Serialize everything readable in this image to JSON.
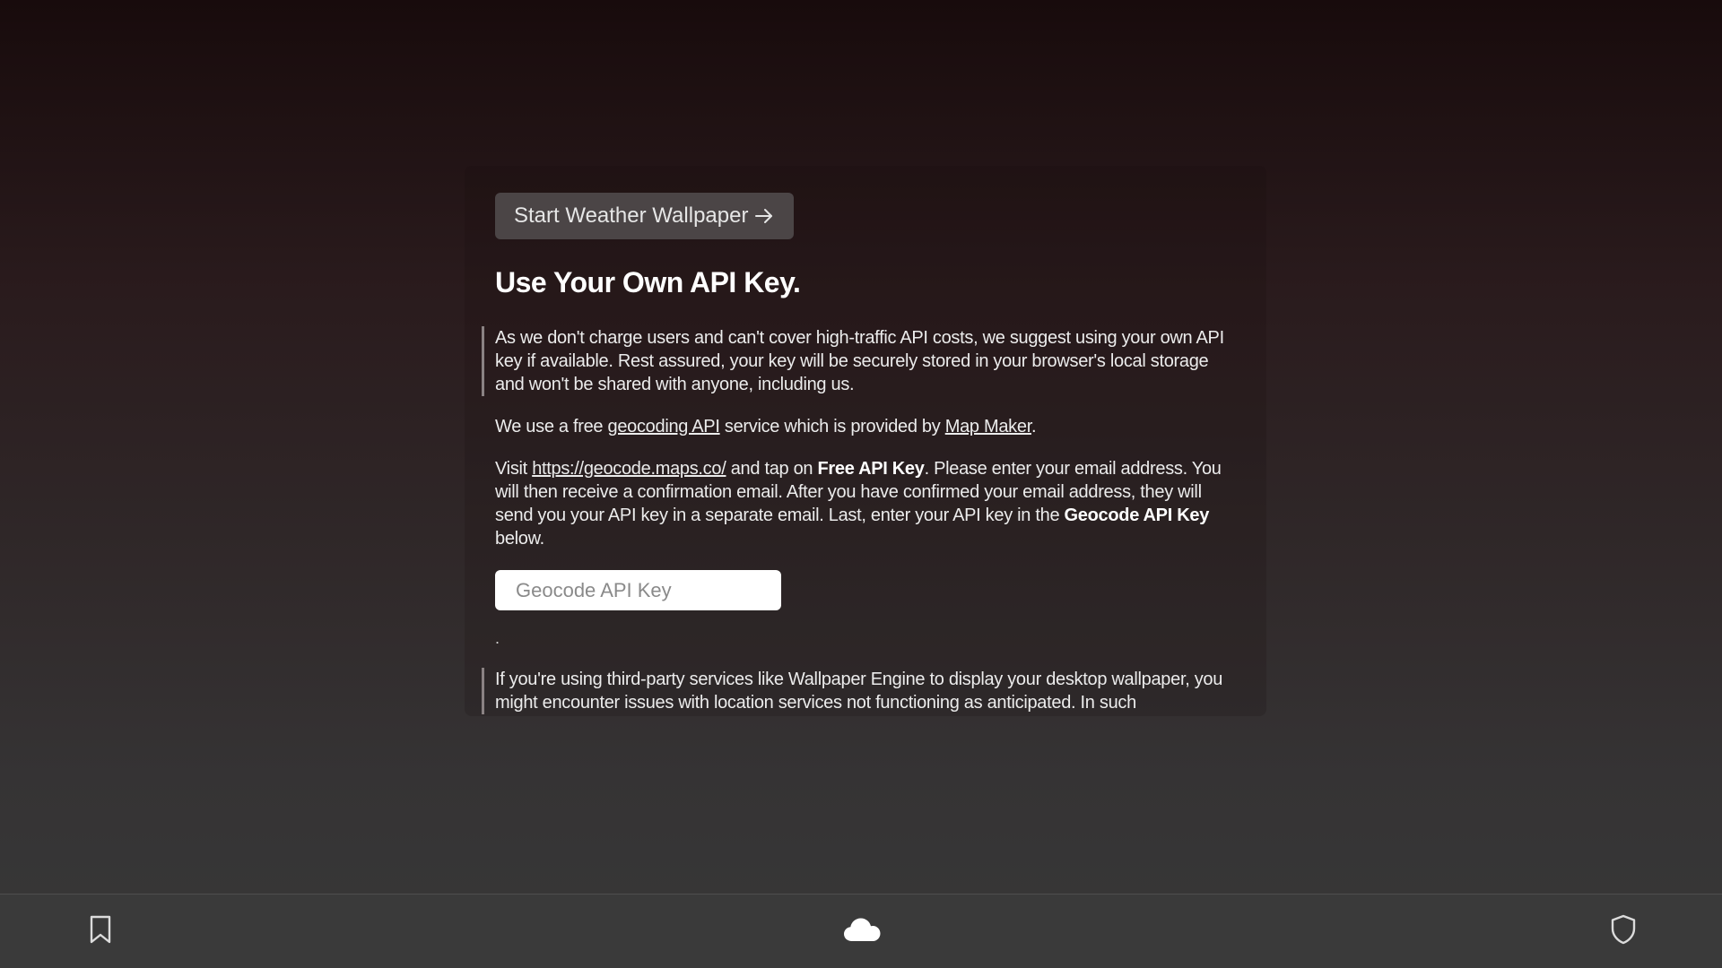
{
  "start_button": {
    "label": "Start Weather Wallpaper",
    "icon": "arrow-right-icon"
  },
  "heading": "Use Your Own API Key.",
  "intro_paragraph": "As we don't charge users and can't cover high-traffic API costs, we suggest using your own API key if available. Rest assured, your key will be securely stored in your browser's local storage and won't be shared with anyone, including us.",
  "provider_paragraph": {
    "prefix": "We use a free ",
    "link1": "geocoding API",
    "middle": " service which is provided by ",
    "link2": "Map Maker",
    "suffix": "."
  },
  "instructions_paragraph": {
    "prefix": "Visit ",
    "link": "https://geocode.maps.co/",
    "part2": " and tap on ",
    "bold1": "Free API Key",
    "part3": ". Please enter your email address. You will then receive a confirmation email. After you have confirmed your email address, they will send you your API key in a separate email. Last, enter your API key in the ",
    "bold2": "Geocode API Key",
    "suffix": " below."
  },
  "api_key_input": {
    "placeholder": "Geocode API Key",
    "value": ""
  },
  "separator_text": ".",
  "third_party_paragraph": "If you're using third-party services like Wallpaper Engine to display your desktop wallpaper, you might encounter issues with location services not functioning as anticipated. In such",
  "bottom_bar": {
    "left_icon": "bookmark-icon",
    "center_icon": "cloud-icon",
    "right_icon": "shield-icon"
  },
  "colors": {
    "background_top": "#180b0c",
    "background_bottom": "#383838",
    "button_bg": "#4b4546",
    "bottom_bar_bg": "#3a3a3a"
  }
}
